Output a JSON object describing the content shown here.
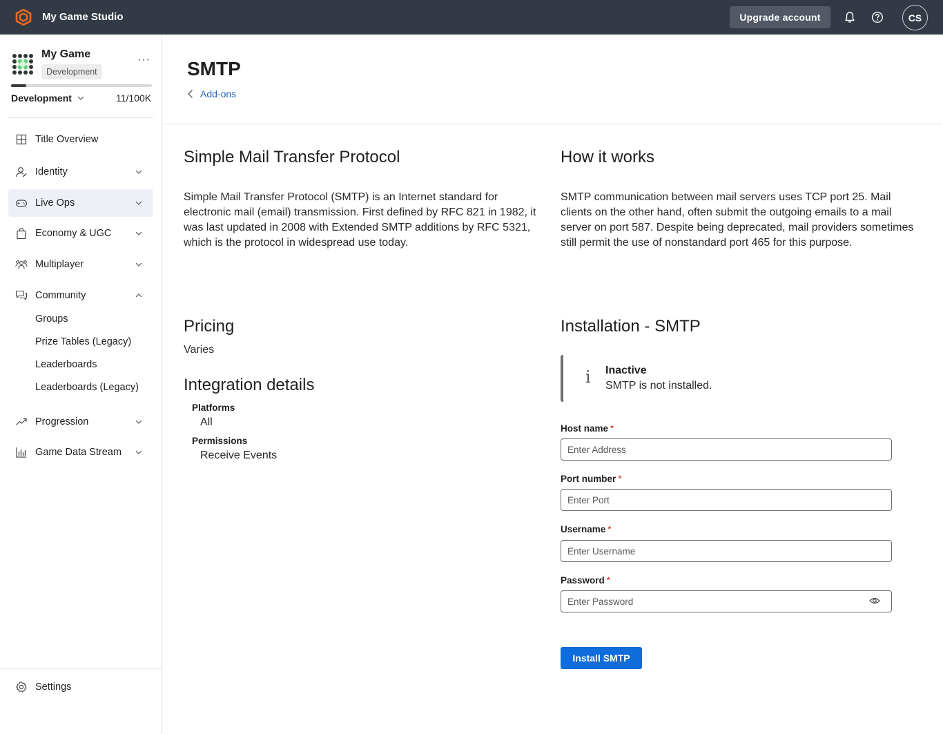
{
  "topbar": {
    "studio_name": "My Game Studio",
    "upgrade_label": "Upgrade account",
    "avatar_initials": "CS"
  },
  "sidebar": {
    "game_name": "My Game",
    "env_chip": "Development",
    "env_select": "Development",
    "usage": "11/100K",
    "usage_fraction": 0.11,
    "nav": [
      {
        "label": "Title Overview",
        "icon": "grid-icon"
      },
      {
        "label": "Identity",
        "icon": "identity-icon"
      },
      {
        "label": "Live Ops",
        "icon": "gamepad-icon"
      },
      {
        "label": "Economy & UGC",
        "icon": "shopping-bag-icon"
      },
      {
        "label": "Multiplayer",
        "icon": "people-icon"
      },
      {
        "label": "Community",
        "icon": "chat-icon"
      },
      {
        "label": "Progression",
        "icon": "trend-icon"
      },
      {
        "label": "Game Data Stream",
        "icon": "bar-chart-icon"
      }
    ],
    "community_sub": [
      "Groups",
      "Prize Tables (Legacy)",
      "Leaderboards",
      "Leaderboards (Legacy)"
    ],
    "settings_label": "Settings"
  },
  "main": {
    "title": "SMTP",
    "breadcrumb": "Add-ons",
    "about_heading": "Simple Mail Transfer Protocol",
    "about_text": "Simple Mail Transfer Protocol (SMTP) is an Internet standard for electronic mail (email) transmission. First defined by RFC 821 in 1982, it was last updated in 2008 with Extended SMTP additions by RFC 5321, which is the protocol in widespread use today.",
    "how_heading": "How it works",
    "how_text": "SMTP communication between mail servers uses TCP port 25. Mail clients on the other hand, often submit the outgoing emails to a mail server on port 587. Despite being deprecated, mail providers sometimes still permit the use of nonstandard port 465 for this purpose.",
    "pricing_heading": "Pricing",
    "pricing_value": "Varies",
    "integration_heading": "Integration details",
    "platforms_label": "Platforms",
    "platforms_value": "All",
    "permissions_label": "Permissions",
    "permissions_value": "Receive Events",
    "install_heading": "Installation - SMTP",
    "status_icon": "i",
    "status_title": "Inactive",
    "status_msg": "SMTP is not installed.",
    "fields": [
      {
        "label": "Host name",
        "placeholder": "Enter Address"
      },
      {
        "label": "Port number",
        "placeholder": "Enter Port"
      },
      {
        "label": "Username",
        "placeholder": "Enter Username"
      },
      {
        "label": "Password",
        "placeholder": "Enter Password"
      }
    ],
    "required_marker": "*",
    "install_button": "Install SMTP"
  },
  "colors": {
    "topbar_bg": "#343a45",
    "accent": "#0f6cdc",
    "link": "#2461b8",
    "required": "#c42b1c"
  }
}
